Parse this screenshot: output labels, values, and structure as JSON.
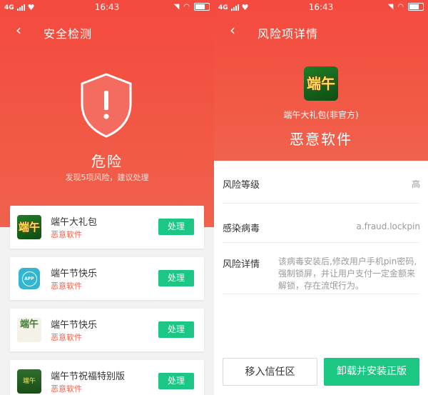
{
  "status_bar": {
    "network": "4G",
    "time": "16:43"
  },
  "left": {
    "title": "安全检测",
    "status": "危险",
    "summary": "发现5项风险，建议处理",
    "items": [
      {
        "name": "端午大礼包",
        "tag": "恶意软件",
        "action": "处理",
        "icon_text": "端午"
      },
      {
        "name": "端午节快乐",
        "tag": "恶意软件",
        "action": "处理",
        "icon_text": "APP"
      },
      {
        "name": "端午节快乐",
        "tag": "恶意软件",
        "action": "处理",
        "icon_text": "端午"
      },
      {
        "name": "端午节祝福特别版",
        "tag": "恶意软件",
        "action": "处理",
        "icon_text": "端午"
      }
    ]
  },
  "right": {
    "title": "风险项详情",
    "app_icon_text": "端午",
    "app_name": "端午大礼包(非官方)",
    "verdict": "恶意软件",
    "level_label": "风险等级",
    "level_value": "高",
    "virus_label": "感染病毒",
    "virus_value": "a.fraud.lockpin",
    "detail_label": "风险详情",
    "detail_text": "该病毒安装后,修改用户手机pin密码,强制锁屏，并让用户支付一定金额来解锁，存在流氓行为。",
    "btn_trust": "移入信任区",
    "btn_uninstall": "卸载并安装正版"
  },
  "colors": {
    "accent_red": "#f44a3f",
    "accent_green": "#1bc783",
    "tag_red": "#f0624c"
  },
  "icons": [
    "back-arrow-icon",
    "shield-exclamation-icon",
    "heart-icon",
    "signal-bars-icon",
    "wifi-icon",
    "battery-icon",
    "mute-icon"
  ]
}
